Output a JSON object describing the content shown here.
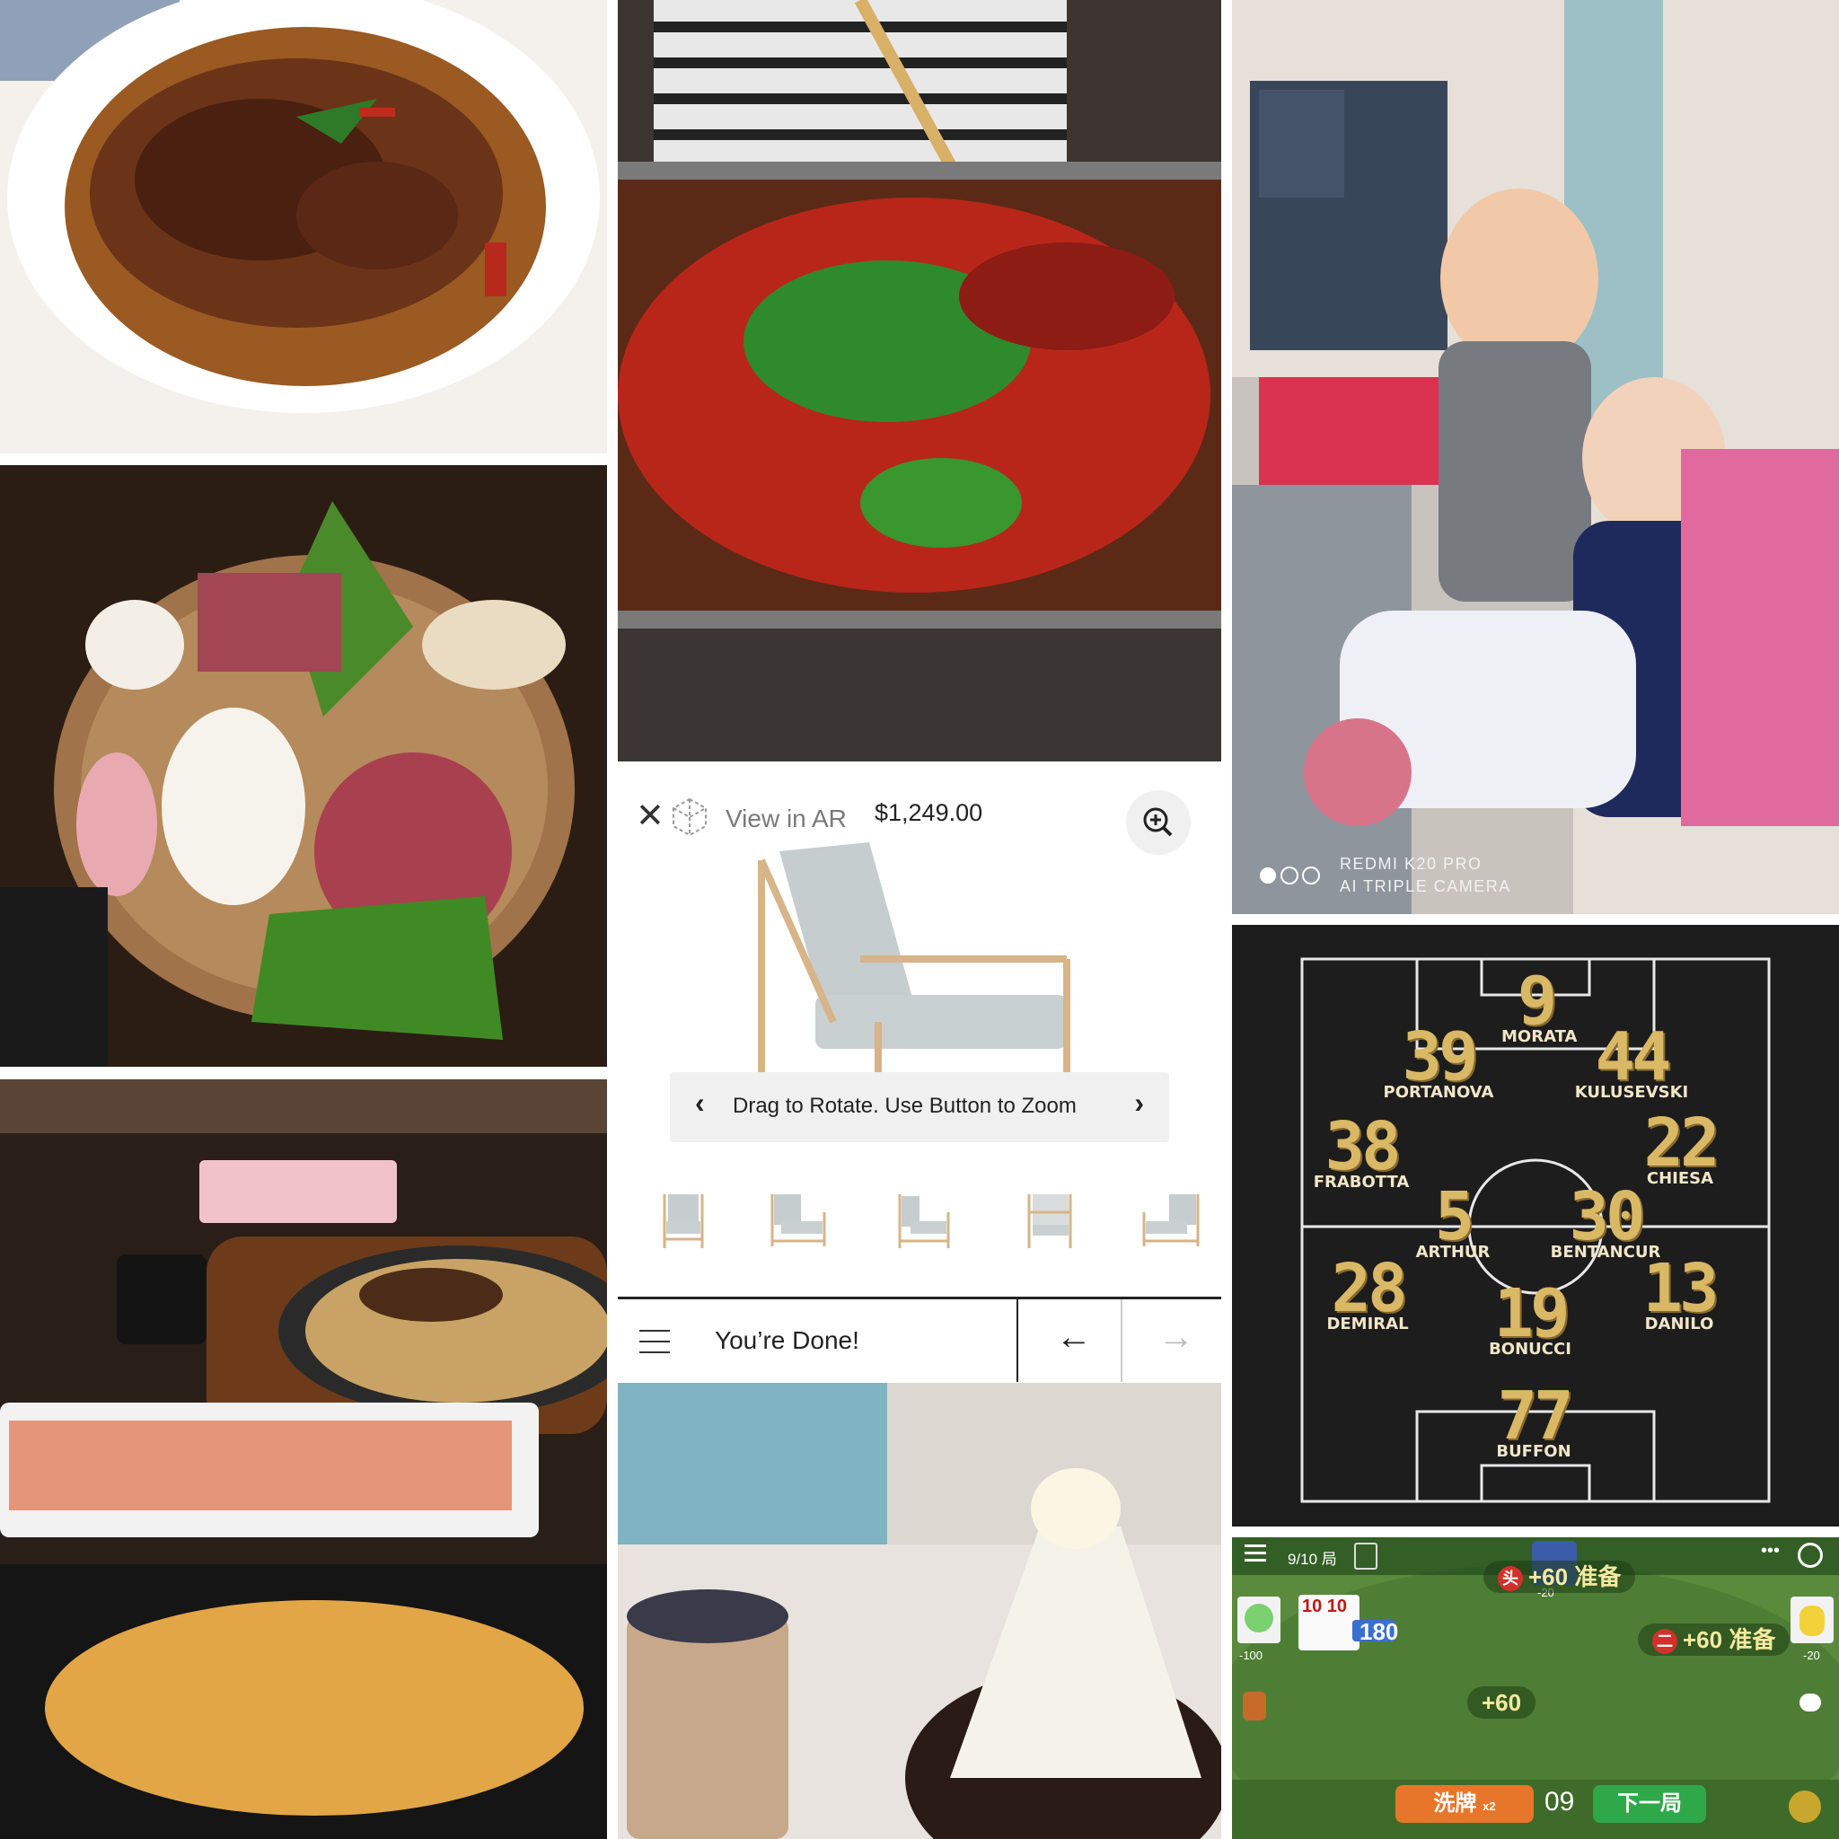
{
  "ar_viewer": {
    "view_in_ar": "View in AR",
    "price": "$1,249.00",
    "hint": "Drag to Rotate. Use Button to Zoom",
    "done_label": "You’re Done!",
    "thumbnail_count": 5
  },
  "phone_watermark": {
    "line1": "REDMI K20 PRO",
    "line2": "AI TRIPLE CAMERA"
  },
  "lineup": {
    "players": [
      {
        "number": "9",
        "name": "MORATA"
      },
      {
        "number": "39",
        "name": "PORTANOVA"
      },
      {
        "number": "44",
        "name": "KULUSEVSKI"
      },
      {
        "number": "38",
        "name": "FRABOTTA"
      },
      {
        "number": "22",
        "name": "CHIESA"
      },
      {
        "number": "5",
        "name": "ARTHUR"
      },
      {
        "number": "30",
        "name": "BENTANCUR"
      },
      {
        "number": "28",
        "name": "DEMIRAL"
      },
      {
        "number": "19",
        "name": "BONUCCI"
      },
      {
        "number": "13",
        "name": "DANILO"
      },
      {
        "number": "77",
        "name": "BUFFON"
      }
    ]
  },
  "card_game": {
    "round": "9/10 局",
    "top_player_badge": "头",
    "top_player_score": "+60 准备",
    "top_player_points": "-20",
    "left_player_points": "-100",
    "cards": "10 10",
    "bid": "180",
    "right_player_badge": "二",
    "right_player_score": "+60 准备",
    "right_player_points": "-20",
    "center_score": "+60",
    "shuffle_label": "洗牌",
    "shuffle_count": "x2",
    "timer": "09",
    "next_round_label": "下一局"
  }
}
